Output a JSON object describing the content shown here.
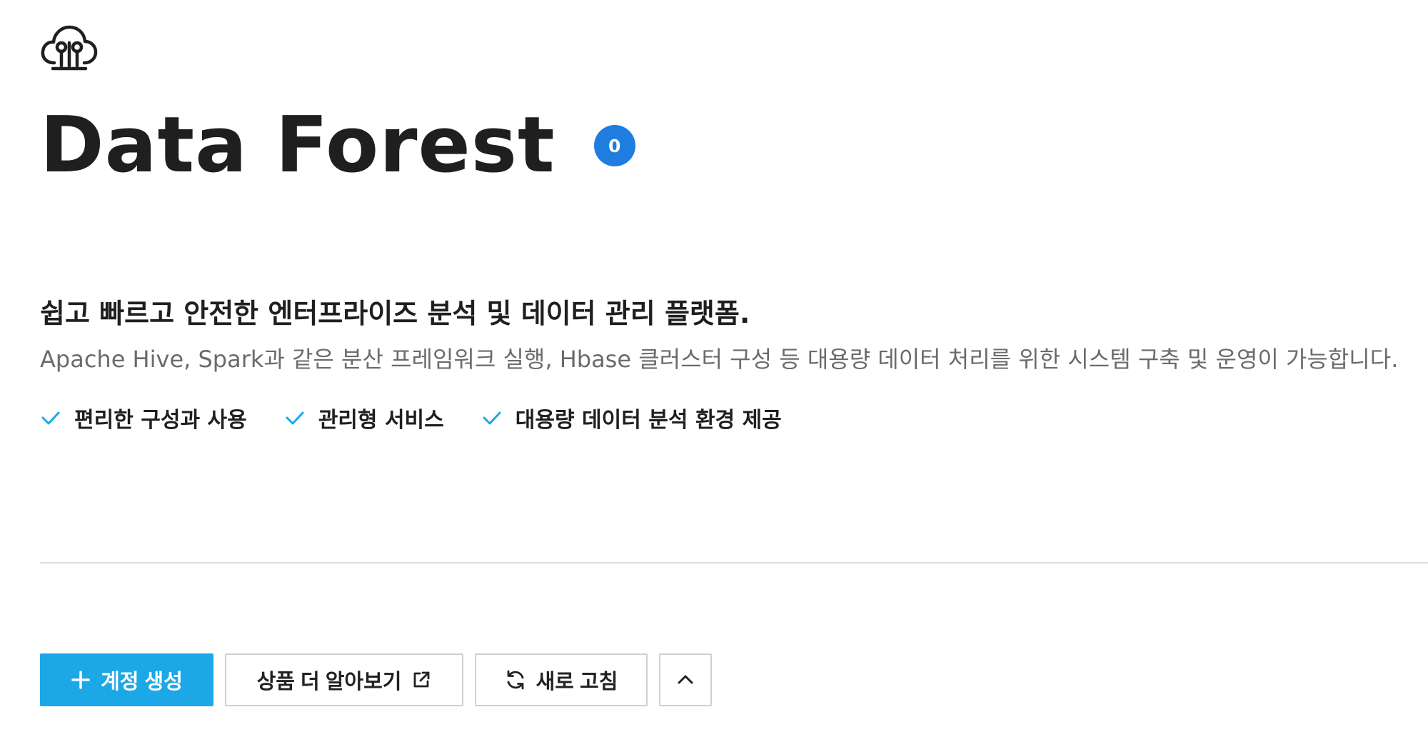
{
  "product": {
    "name": "Data Forest",
    "badge_count": "0",
    "logo_icon": "cloud-tree-icon"
  },
  "headline": "쉽고 빠르고 안전한 엔터프라이즈 분석 및 데이터 관리 플랫폼.",
  "description": "Apache Hive, Spark과 같은 분산 프레임워크 실행, Hbase 클러스터 구성 등 대용량 데이터 처리를 위한 시스템 구축 및 운영이 가능합니다.",
  "features": [
    {
      "label": "편리한 구성과 사용",
      "icon": "check-icon"
    },
    {
      "label": "관리형 서비스",
      "icon": "check-icon"
    },
    {
      "label": "대용량 데이터 분석 환경 제공",
      "icon": "check-icon"
    }
  ],
  "actions": {
    "create_account": {
      "label": "계정 생성",
      "icon": "plus-icon"
    },
    "learn_more": {
      "label": "상품 더 알아보기",
      "icon": "external-link-icon"
    },
    "refresh": {
      "label": "새로 고침",
      "icon": "refresh-icon"
    },
    "collapse": {
      "icon": "chevron-up-icon"
    }
  },
  "colors": {
    "primary": "#1ca8e6",
    "badge": "#1f7de0",
    "check": "#1ca8e6",
    "divider": "#dcdcdc"
  }
}
